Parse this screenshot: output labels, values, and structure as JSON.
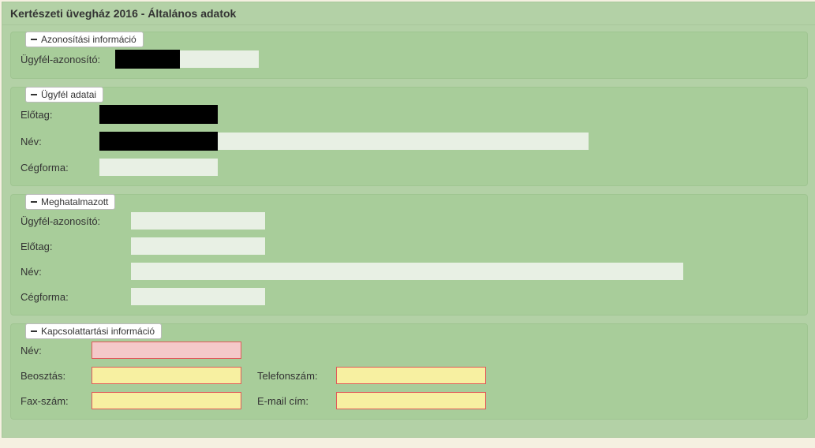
{
  "header": {
    "title": "Kertészeti üvegház 2016 - Általános adatok"
  },
  "sections": {
    "identification": {
      "legend": "Azonosítási információ",
      "fields": {
        "customerId": {
          "label": "Ügyfél-azonosító:",
          "value": "",
          "redacted": true
        }
      }
    },
    "customer": {
      "legend": "Ügyfél adatai",
      "fields": {
        "prefix": {
          "label": "Előtag:",
          "value": "",
          "redacted": true
        },
        "name": {
          "label": "Név:",
          "value": "",
          "redacted": true
        },
        "company": {
          "label": "Cégforma:",
          "value": ""
        }
      }
    },
    "authorized": {
      "legend": "Meghatalmazott",
      "fields": {
        "customerId": {
          "label": "Ügyfél-azonosító:",
          "value": ""
        },
        "prefix": {
          "label": "Előtag:",
          "value": ""
        },
        "name": {
          "label": "Név:",
          "value": ""
        },
        "company": {
          "label": "Cégforma:",
          "value": ""
        }
      }
    },
    "contact": {
      "legend": "Kapcsolattartási információ",
      "fields": {
        "name": {
          "label": "Név:",
          "value": "",
          "state": "required"
        },
        "role": {
          "label": "Beosztás:",
          "value": "",
          "state": "warn"
        },
        "phone": {
          "label": "Telefonszám:",
          "value": "",
          "state": "warn"
        },
        "fax": {
          "label": "Fax-szám:",
          "value": "",
          "state": "warn"
        },
        "email": {
          "label": "E-mail cím:",
          "value": "",
          "state": "warn"
        }
      }
    }
  }
}
